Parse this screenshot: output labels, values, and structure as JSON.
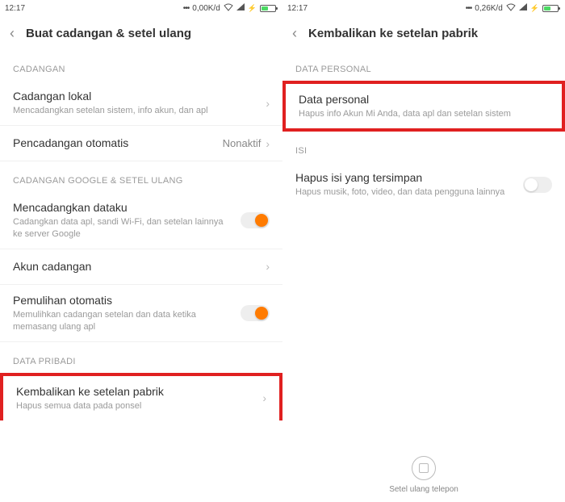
{
  "left": {
    "status": {
      "time": "12:17",
      "net": "0,00K/d"
    },
    "header": {
      "title": "Buat cadangan & setel ulang"
    },
    "section1": {
      "label": "CADANGAN"
    },
    "row_cadangan_lokal": {
      "title": "Cadangan lokal",
      "sub": "Mencadangkan setelan sistem, info akun, dan apl"
    },
    "row_pencadangan_otomatis": {
      "title": "Pencadangan otomatis",
      "value": "Nonaktif"
    },
    "section2": {
      "label": "CADANGAN GOOGLE & SETEL ULANG"
    },
    "row_mencadangkan": {
      "title": "Mencadangkan dataku",
      "sub": "Cadangkan data apl, sandi Wi-Fi, dan setelan lainnya ke server Google"
    },
    "row_akun_cadangan": {
      "title": "Akun cadangan"
    },
    "row_pemulihan": {
      "title": "Pemulihan otomatis",
      "sub": "Memulihkan cadangan setelan dan data ketika memasang ulang apl"
    },
    "section3": {
      "label": "DATA PRIBADI"
    },
    "row_kembalikan": {
      "title": "Kembalikan ke setelan pabrik",
      "sub": "Hapus semua data pada ponsel"
    }
  },
  "right": {
    "status": {
      "time": "12:17",
      "net": "0,26K/d"
    },
    "header": {
      "title": "Kembalikan ke setelan pabrik"
    },
    "section1": {
      "label": "DATA PERSONAL"
    },
    "row_data_personal": {
      "title": "Data personal",
      "sub": "Hapus info Akun Mi Anda, data apl dan setelan sistem"
    },
    "section2": {
      "label": "ISI"
    },
    "row_hapus_isi": {
      "title": "Hapus isi yang tersimpan",
      "sub": "Hapus musik, foto, video, dan data pengguna lainnya"
    },
    "bottom": {
      "label": "Setel ulang telepon"
    }
  }
}
